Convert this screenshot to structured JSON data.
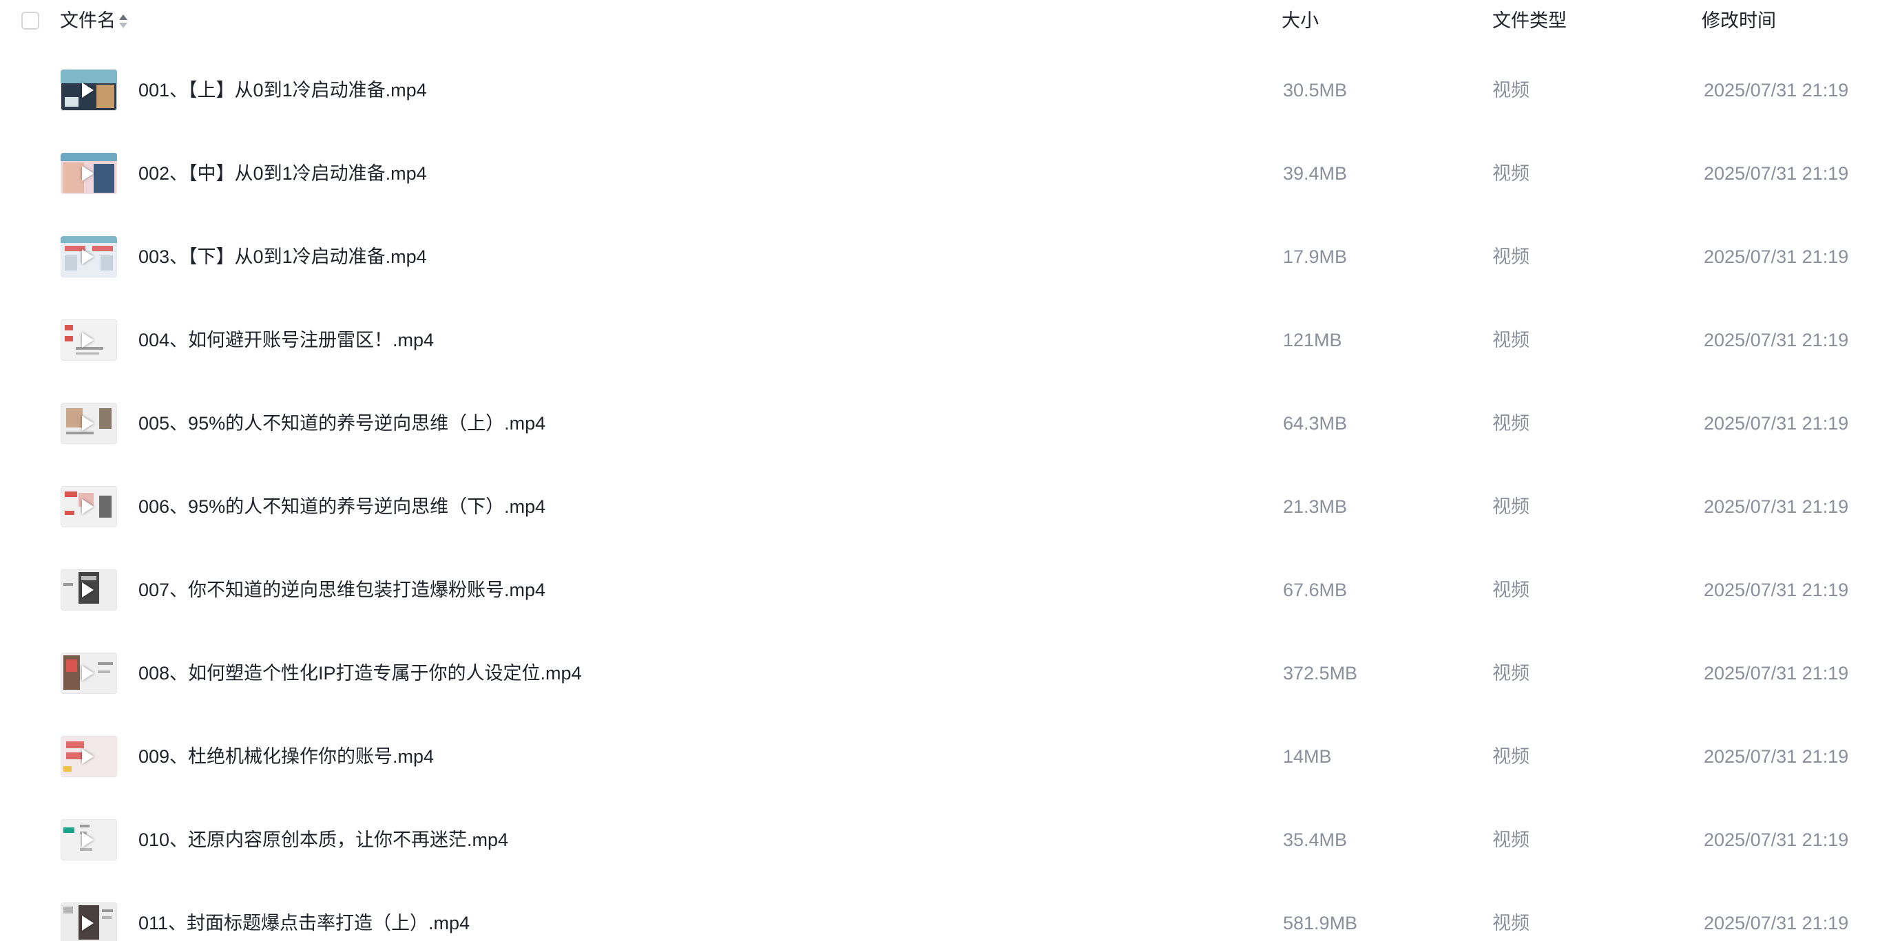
{
  "header": {
    "name_label": "文件名",
    "size_label": "大小",
    "type_label": "文件类型",
    "modified_label": "修改时间"
  },
  "files": [
    {
      "name": "001、【上】从0到1冷启动准备.mp4",
      "size": "30.5MB",
      "type": "视频",
      "modified": "2025/07/31 21:19"
    },
    {
      "name": "002、【中】从0到1冷启动准备.mp4",
      "size": "39.4MB",
      "type": "视频",
      "modified": "2025/07/31 21:19"
    },
    {
      "name": "003、【下】从0到1冷启动准备.mp4",
      "size": "17.9MB",
      "type": "视频",
      "modified": "2025/07/31 21:19"
    },
    {
      "name": "004、如何避开账号注册雷区！.mp4",
      "size": "121MB",
      "type": "视频",
      "modified": "2025/07/31 21:19"
    },
    {
      "name": "005、95%的人不知道的养号逆向思维（上）.mp4",
      "size": "64.3MB",
      "type": "视频",
      "modified": "2025/07/31 21:19"
    },
    {
      "name": "006、95%的人不知道的养号逆向思维（下）.mp4",
      "size": "21.3MB",
      "type": "视频",
      "modified": "2025/07/31 21:19"
    },
    {
      "name": "007、你不知道的逆向思维包装打造爆粉账号.mp4",
      "size": "67.6MB",
      "type": "视频",
      "modified": "2025/07/31 21:19"
    },
    {
      "name": "008、如何塑造个性化IP打造专属于你的人设定位.mp4",
      "size": "372.5MB",
      "type": "视频",
      "modified": "2025/07/31 21:19"
    },
    {
      "name": "009、杜绝机械化操作你的账号.mp4",
      "size": "14MB",
      "type": "视频",
      "modified": "2025/07/31 21:19"
    },
    {
      "name": "010、还原内容原创本质，让你不再迷茫.mp4",
      "size": "35.4MB",
      "type": "视频",
      "modified": "2025/07/31 21:19"
    },
    {
      "name": "011、封面标题爆点击率打造（上）.mp4",
      "size": "581.9MB",
      "type": "视频",
      "modified": "2025/07/31 21:19"
    }
  ],
  "colors": {
    "text_primary": "#1f2329",
    "text_secondary": "#8a8f99",
    "checkbox_border": "#d4d6dc"
  },
  "icons": {
    "sort": "sort-icon",
    "play": "play-icon"
  }
}
